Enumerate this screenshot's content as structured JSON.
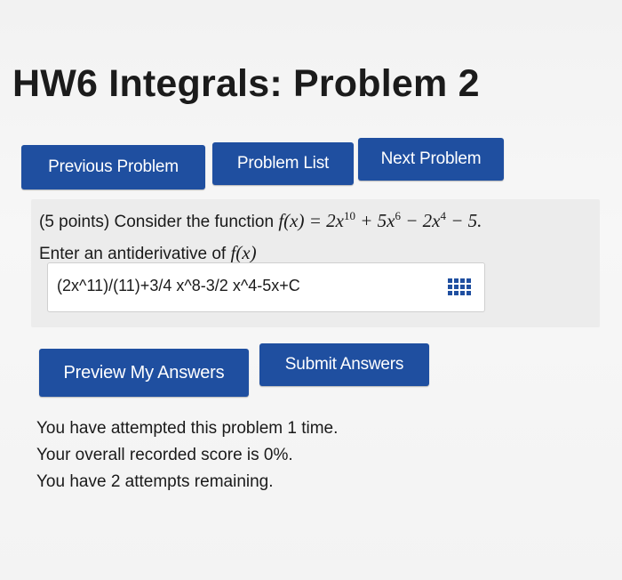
{
  "page": {
    "title": "HW6 Integrals: Problem 2"
  },
  "nav": {
    "previous_label": "Previous Problem",
    "list_label": "Problem List",
    "next_label": "Next Problem"
  },
  "problem": {
    "statement_text": "(5 points) Consider the function",
    "function_lhs": "f(x) = 2x",
    "exp1": "10",
    "term2": " + 5x",
    "exp2": "6",
    "term3": " − 2x",
    "exp3": "4",
    "term4": " − 5.",
    "prompt_text": "Enter an antiderivative of",
    "prompt_math": "f(x)",
    "answer_value": "(2x^11)/(11)+3/4 x^8-3/2 x^4-5x+C"
  },
  "actions": {
    "preview_label": "Preview My Answers",
    "submit_label": "Submit Answers"
  },
  "status": {
    "attempts_line": "You have attempted this problem 1 time.",
    "score_line": "Your overall recorded score is 0%.",
    "remaining_line": "You have 2 attempts remaining."
  },
  "colors": {
    "button_blue": "#1f4fa0",
    "panel_gray": "#ececec"
  },
  "icons": {
    "equation_editor": "grid-icon"
  }
}
